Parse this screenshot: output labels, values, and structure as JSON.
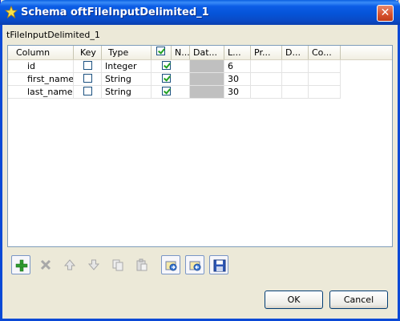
{
  "window": {
    "title": "Schema oftFileInputDelimited_1",
    "close_label": "✕"
  },
  "subtitle": "tFileInputDelimited_1",
  "table": {
    "columns": [
      "Column",
      "Key",
      "Type",
      "",
      "N...",
      "Dat...",
      "L...",
      "Pr...",
      "D...",
      "Co..."
    ],
    "header_checkbox_checked": true,
    "rows": [
      {
        "column": "id",
        "key": false,
        "type": "Integer",
        "nullable": true,
        "length": "6"
      },
      {
        "column": "first_name",
        "key": false,
        "type": "String",
        "nullable": true,
        "length": "30"
      },
      {
        "column": "last_name",
        "key": false,
        "type": "String",
        "nullable": true,
        "length": "30"
      }
    ]
  },
  "toolbar": {
    "icons": [
      "add-icon",
      "remove-icon",
      "move-up-icon",
      "move-down-icon",
      "copy-icon",
      "paste-icon",
      "import-icon",
      "export-icon",
      "save-icon"
    ],
    "enabled": [
      true,
      false,
      false,
      false,
      false,
      false,
      true,
      true,
      true
    ]
  },
  "buttons": {
    "ok": "OK",
    "cancel": "Cancel"
  },
  "colors": {
    "titlebar": "#0554d8",
    "background": "#ece9d8",
    "check": "#21a121"
  }
}
